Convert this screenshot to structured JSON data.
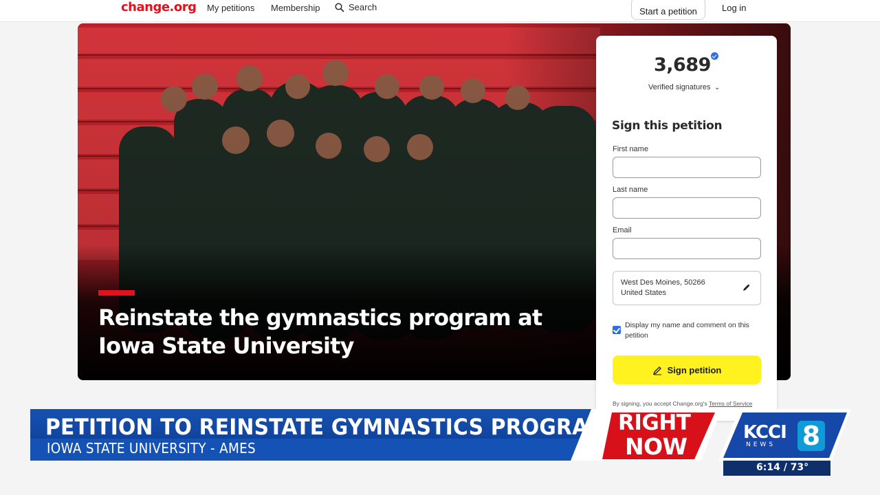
{
  "nav": {
    "logo": "change.org",
    "my_petitions": "My petitions",
    "membership": "Membership",
    "search": "Search",
    "start_petition": "Start a petition",
    "login": "Log in"
  },
  "hero": {
    "title": "Reinstate the gymnastics program at Iowa State University"
  },
  "card": {
    "signature_count": "3,689",
    "verified_label": "Verified signatures",
    "sign_heading": "Sign this petition",
    "first_name_label": "First name",
    "last_name_label": "Last name",
    "email_label": "Email",
    "first_name_value": "",
    "last_name_value": "",
    "email_value": "",
    "location_line1": "West Des Moines, 50266",
    "location_line2": "United States",
    "display_checkbox_label": "Display my name and comment on this petition",
    "display_checked": true,
    "sign_button": "Sign petition",
    "terms_prefix": "By signing, you accept Change.org's ",
    "terms_link": "Terms of Service"
  },
  "lower_third": {
    "headline": "PETITION TO REINSTATE GYMNASTICS PROGRAM",
    "subline": "IOWA STATE UNIVERSITY - AMES",
    "right_now_1": "RIGHT",
    "right_now_2": "NOW",
    "station": "KCCI",
    "station_news": "NEWS",
    "channel": "8",
    "time_temp": "6:14 / 73°"
  },
  "colors": {
    "brand_red": "#e2111e",
    "sign_yellow": "#fff21f",
    "check_blue": "#2e6ee6",
    "news_blue": "#1452b5",
    "news_red": "#d8101a"
  },
  "icons": [
    "search-icon",
    "verified-badge-icon",
    "chevron-down-icon",
    "pencil-icon",
    "pen-sign-icon",
    "checkmark-icon"
  ]
}
